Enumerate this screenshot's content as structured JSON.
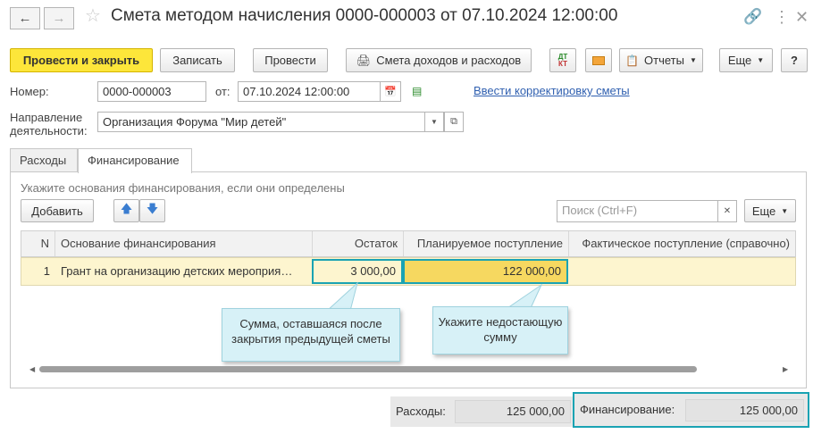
{
  "window": {
    "title": "Смета методом начисления 0000-000003 от 07.10.2024 12:00:00"
  },
  "toolbar": {
    "post_close_label": "Провести и закрыть",
    "save_label": "Записать",
    "post_label": "Провести",
    "budget_label": "Смета доходов и расходов",
    "dtkt_label_top": "ДТ",
    "dtkt_label_bottom": "КТ",
    "reports_label": "Отчеты",
    "more_label": "Еще",
    "help_label": "?"
  },
  "form": {
    "number_label": "Номер:",
    "number_value": "0000-000003",
    "date_label": "от:",
    "date_value": "07.10.2024 12:00:00",
    "correction_link": "Ввести корректировку сметы",
    "direction_label_line1": "Направление",
    "direction_label_line2": "деятельности:",
    "direction_value": "Организация Форума \"Мир детей\""
  },
  "tabs": [
    {
      "label": "Расходы",
      "active": false
    },
    {
      "label": "Финансирование",
      "active": true
    }
  ],
  "financing": {
    "hint": "Укажите основания финансирования, если они определены",
    "add_label": "Добавить",
    "search_placeholder": "Поиск (Ctrl+F)",
    "more_label": "Еще",
    "columns": [
      "N",
      "Основание финансирования",
      "Остаток",
      "Планируемое поступление",
      "Фактическое поступление (справочно)"
    ],
    "rows": [
      {
        "n": "1",
        "basis": "Грант на организацию детских мероприя…",
        "remainder": "3 000,00",
        "planned": "122 000,00",
        "actual": ""
      }
    ]
  },
  "callouts": {
    "remainder_note": [
      "Сумма, оставшаяся после",
      "закрытия предыдущей сметы"
    ],
    "planned_note": [
      "Укажите недостающую",
      "сумму"
    ]
  },
  "totals": {
    "expenses_label": "Расходы:",
    "expenses_value": "125 000,00",
    "financing_label": "Финансирование:",
    "financing_value": "125 000,00"
  },
  "colors": {
    "primary_button": "#fde63a",
    "highlight_frame": "#1aa3b3",
    "selected_row": "#fdf5cf",
    "planned_cell": "#f6d860",
    "callout_bg": "#d7f1f7",
    "link": "#3060b0"
  }
}
